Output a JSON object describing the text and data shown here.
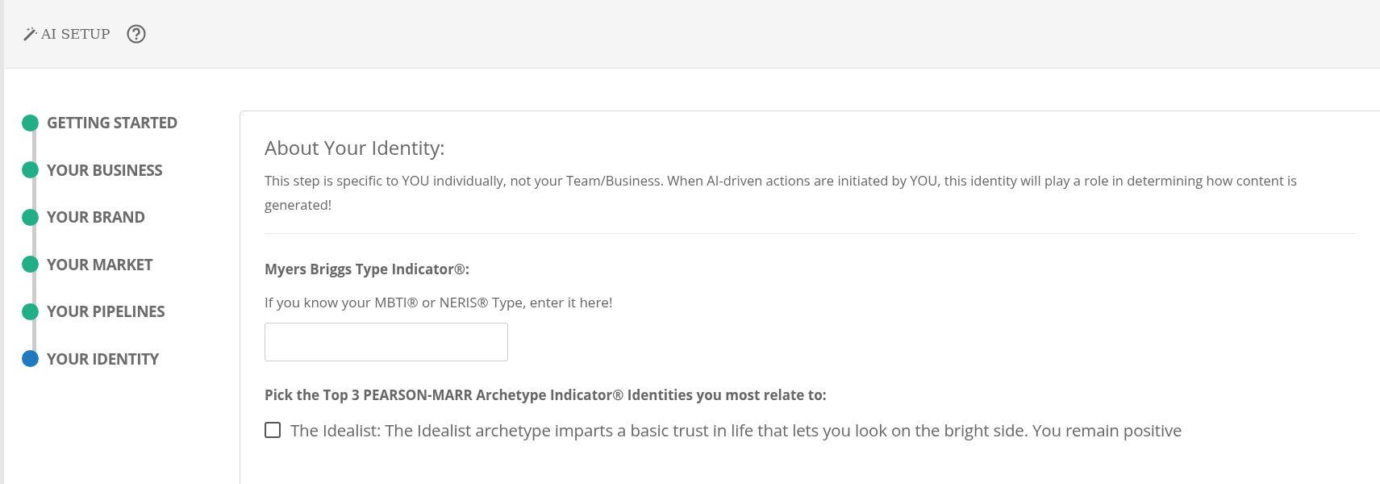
{
  "header": {
    "title": "AI SETUP"
  },
  "steps": [
    {
      "label": "GETTING STARTED",
      "selected": false
    },
    {
      "label": "YOUR BUSINESS",
      "selected": false
    },
    {
      "label": "YOUR BRAND",
      "selected": false
    },
    {
      "label": "YOUR MARKET",
      "selected": false
    },
    {
      "label": "YOUR PIPELINES",
      "selected": false
    },
    {
      "label": "YOUR IDENTITY",
      "selected": true
    }
  ],
  "card": {
    "heading": "About Your Identity:",
    "intro": "This step is specific to YOU individually, not your Team/Business. When AI-driven actions are initiated by YOU, this identity will play a role in determining how content is generated!",
    "mbti": {
      "label": "Myers Briggs Type Indicator®:",
      "hint": "If you know your MBTI® or NERIS® Type, enter it here!"
    },
    "archetypes": {
      "label": "Pick the Top 3 PEARSON-MARR Archetype Indicator® Identities you most relate to:",
      "options": [
        {
          "text": "The Idealist: The Idealist archetype imparts a basic trust in life that lets you look on the bright side. You remain positive",
          "checked": false
        }
      ]
    }
  }
}
